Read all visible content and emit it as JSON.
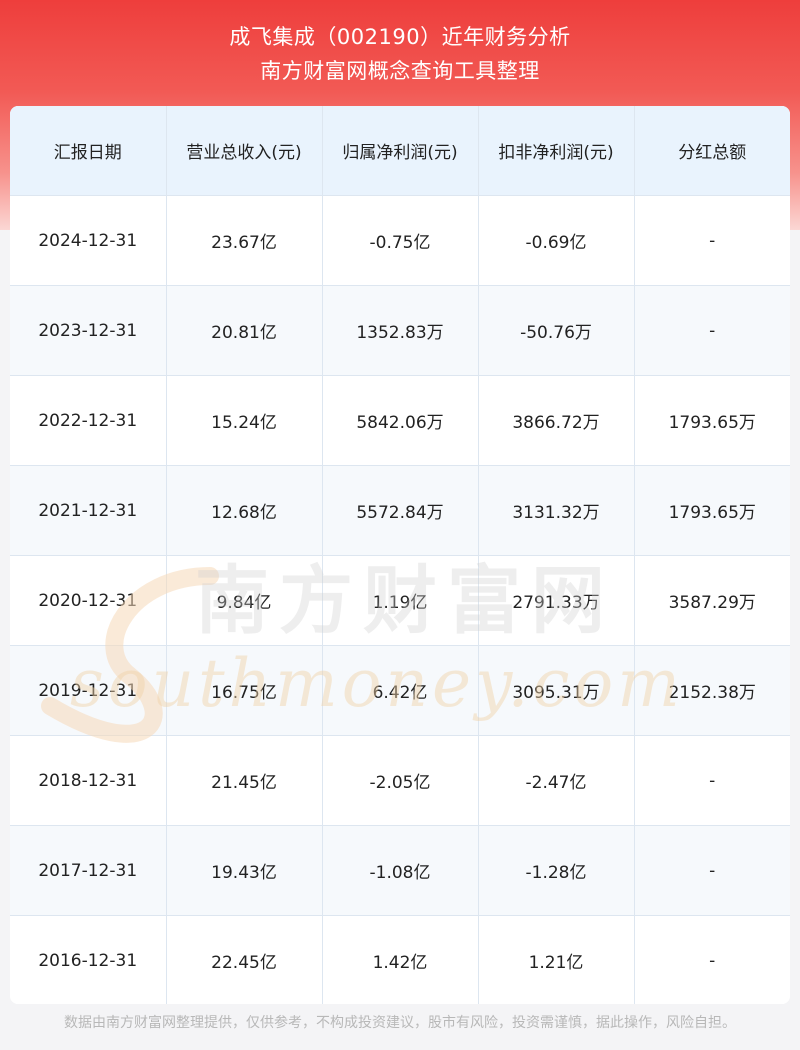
{
  "header": {
    "title_line1": "成飞集成（002190）近年财务分析",
    "title_line2": "南方财富网概念查询工具整理"
  },
  "table": {
    "columns": [
      "汇报日期",
      "营业总收入(元)",
      "归属净利润(元)",
      "扣非净利润(元)",
      "分红总额"
    ],
    "rows": [
      [
        "2024-12-31",
        "23.67亿",
        "-0.75亿",
        "-0.69亿",
        "-"
      ],
      [
        "2023-12-31",
        "20.81亿",
        "1352.83万",
        "-50.76万",
        "-"
      ],
      [
        "2022-12-31",
        "15.24亿",
        "5842.06万",
        "3866.72万",
        "1793.65万"
      ],
      [
        "2021-12-31",
        "12.68亿",
        "5572.84万",
        "3131.32万",
        "1793.65万"
      ],
      [
        "2020-12-31",
        "9.84亿",
        "1.19亿",
        "2791.33万",
        "3587.29万"
      ],
      [
        "2019-12-31",
        "16.75亿",
        "6.42亿",
        "3095.31万",
        "2152.38万"
      ],
      [
        "2018-12-31",
        "21.45亿",
        "-2.05亿",
        "-2.47亿",
        "-"
      ],
      [
        "2017-12-31",
        "19.43亿",
        "-1.08亿",
        "-1.28亿",
        "-"
      ],
      [
        "2016-12-31",
        "22.45亿",
        "1.42亿",
        "1.21亿",
        "-"
      ]
    ]
  },
  "watermark": {
    "cn": "南方财富网",
    "en": "southmoney.com"
  },
  "footer": {
    "disclaimer": "数据由南方财富网整理提供，仅供参考，不构成投资建议，股市有风险，投资需谨慎，据此操作，风险自担。"
  }
}
